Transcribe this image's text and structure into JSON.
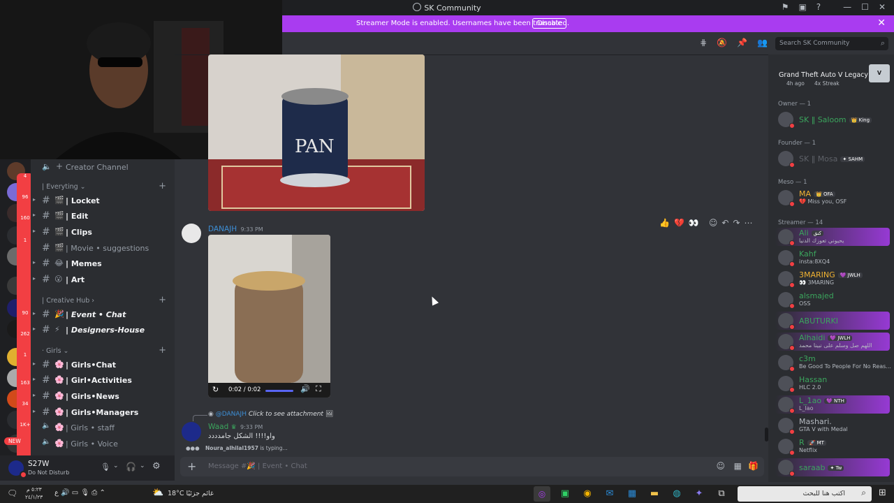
{
  "app": {
    "title": "SK Community",
    "title_icons": [
      "inbox-icon",
      "screen-icon",
      "help-icon",
      "minimize-icon",
      "maximize-icon",
      "close-icon"
    ]
  },
  "banner": {
    "message": "Streamer Mode is enabled. Usernames have been truncated.",
    "button": "Disable"
  },
  "channels": {
    "creator": "Creator Channel",
    "categories": [
      {
        "name": "| Everyting ⌄"
      },
      {
        "name": "| Creative Hub ›"
      },
      {
        "name": "· Girls ⌄"
      }
    ],
    "items": [
      {
        "emoji": "🎬",
        "label": "| Locket"
      },
      {
        "emoji": "🎬",
        "label": "| Edit"
      },
      {
        "emoji": "🎬",
        "label": "| Clips"
      },
      {
        "emoji": "🎬",
        "label": "| Movie • suggestions"
      },
      {
        "emoji": "😂",
        "label": "| Memes"
      },
      {
        "emoji": "😮",
        "label": "| Art"
      },
      {
        "emoji": "🎉",
        "label": "| Event • Chat"
      },
      {
        "emoji": "⚡",
        "label": "| Designers-House"
      },
      {
        "emoji": "🌸",
        "label": "| Girls•Chat"
      },
      {
        "emoji": "🌸",
        "label": "| Girl•Activities"
      },
      {
        "emoji": "🌸",
        "label": "| Girls•News"
      },
      {
        "emoji": "🌸",
        "label": "| Girls•Managers"
      },
      {
        "emoji": "🌸",
        "label": "| Girls • staff"
      },
      {
        "emoji": "🌸",
        "label": "| Girls • Voice"
      }
    ]
  },
  "guild_badges": [
    "4",
    "96",
    "160",
    "1",
    "90",
    "262",
    "1",
    "163",
    "34",
    "1K+",
    "NEW"
  ],
  "user": {
    "name": "S27W",
    "status": "Do Not Disturb"
  },
  "search": {
    "placeholder": "Search SK Community"
  },
  "messages": {
    "msg1": {
      "author": "DANAJH",
      "time": "9:33 PM",
      "video_time": "0:02 / 0:02"
    },
    "msg2": {
      "reply_to": "@DANAJH",
      "reply_text": "Click to see attachment",
      "author": "Waad",
      "time": "9:33 PM",
      "text": "واو!!!! الشكل جامدددد"
    },
    "typing": {
      "user": "Noura_alhilal1957",
      "text": "is typing..."
    },
    "reactions": [
      "👍",
      "💔",
      "👀"
    ]
  },
  "composer": {
    "placeholder": "Message #🎉 | Event • Chat"
  },
  "members": {
    "activity": {
      "game": "Grand Theft Auto V Legacy",
      "time": "4h ago",
      "streak": "4x Streak"
    },
    "groups": [
      {
        "header": "Owner — 1"
      },
      {
        "header": "Founder — 1"
      },
      {
        "header": "Meso — 1"
      },
      {
        "header": "Streamer — 14"
      }
    ],
    "list": [
      {
        "name": "SK ‖ Saloom",
        "tag": "👑 King",
        "sub": "",
        "color": "#3ba55d"
      },
      {
        "name": "SK ‖ Mosa",
        "tag": "✦ SAHM",
        "sub": "",
        "color": "#5e6168"
      },
      {
        "name": "MA",
        "tag": "👑 OFA",
        "sub": "💔 Miss you, OSF",
        "color": "#f0b232"
      },
      {
        "name": "Ali",
        "tag": "كنق",
        "sub": "يحيوني تعوزك الدنيا",
        "color": "#3ba55d"
      },
      {
        "name": "Kahf",
        "tag": "",
        "sub": "insta:8XQ4",
        "color": "#3ba55d"
      },
      {
        "name": "3MARING",
        "tag": "💜 JWLH",
        "sub": "👀 3MARING",
        "color": "#f0b232"
      },
      {
        "name": "alsmajed",
        "tag": "",
        "sub": "OSS",
        "color": "#3ba55d"
      },
      {
        "name": "ABUTURKI",
        "tag": "",
        "sub": "",
        "color": "#3ba55d"
      },
      {
        "name": "Alhaidi",
        "tag": "💜 JWLH",
        "sub": "اللهم صل وسلم على نبينا محمد",
        "color": "#3ba55d"
      },
      {
        "name": "c3m",
        "tag": "",
        "sub": "Be Good To People For No Reas...",
        "color": "#3ba55d"
      },
      {
        "name": "Hassan",
        "tag": "",
        "sub": "HLC 2.0",
        "color": "#3ba55d"
      },
      {
        "name": "L_1ao",
        "tag": "💜 NTH",
        "sub": "L_lao",
        "color": "#3ba55d"
      },
      {
        "name": "Mashari.",
        "tag": "",
        "sub": "GTA V with Medal",
        "color": "#b5bac1"
      },
      {
        "name": "R",
        "tag": "🚀 MT",
        "sub": "Netflix",
        "color": "#3ba55d"
      },
      {
        "name": "saraab",
        "tag": "✦ Tw",
        "sub": "",
        "color": "#3ba55d"
      }
    ]
  },
  "taskbar": {
    "weather": "18°C غائم جزئيًا",
    "search_text": "اكتب هنا للبحث",
    "clock": "٥:٢٣ م",
    "date": "٢٤/١/٢٣"
  },
  "colors": {
    "accent": "#a93cf0",
    "link": "#00a8fc",
    "green": "#3ba55d",
    "bg_main": "#313338",
    "bg_sidebar": "#2b2d31"
  }
}
